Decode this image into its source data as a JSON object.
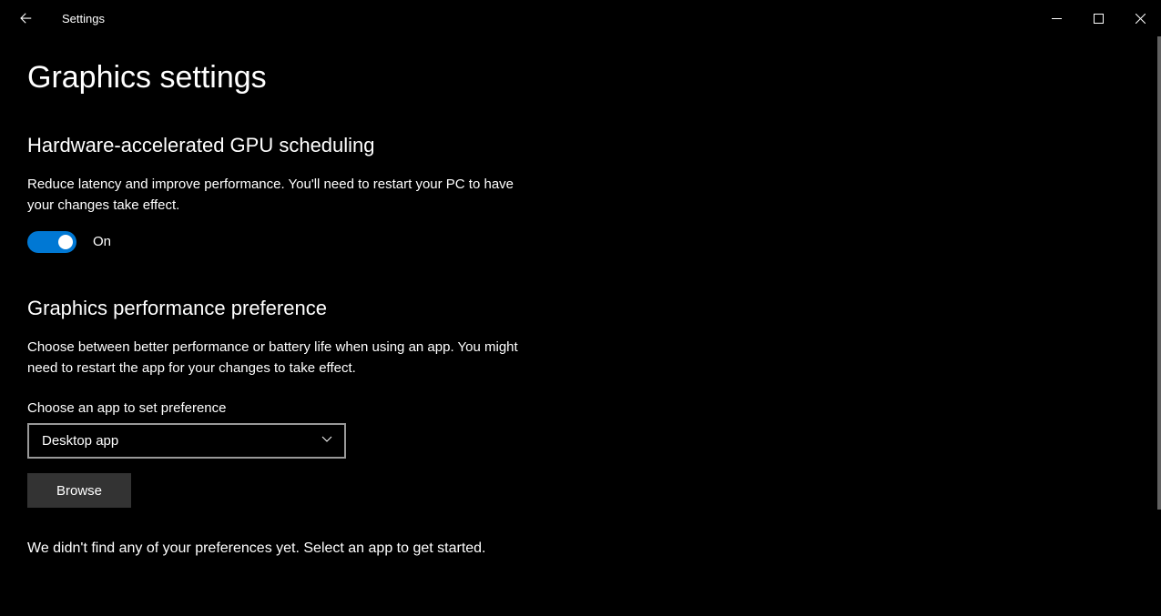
{
  "window": {
    "app_title": "Settings"
  },
  "page": {
    "title": "Graphics settings"
  },
  "gpu_scheduling": {
    "heading": "Hardware-accelerated GPU scheduling",
    "description": "Reduce latency and improve performance. You'll need to restart your PC to have your changes take effect.",
    "toggle_state": "On",
    "toggle_on": true
  },
  "performance_pref": {
    "heading": "Graphics performance preference",
    "description": "Choose between better performance or battery life when using an app. You might need to restart the app for your changes to take effect.",
    "choose_label": "Choose an app to set preference",
    "dropdown_value": "Desktop app",
    "browse_label": "Browse",
    "empty_message": "We didn't find any of your preferences yet. Select an app to get started."
  },
  "colors": {
    "accent": "#0078d4",
    "background": "#000000",
    "button_bg": "#333333",
    "border": "#999999"
  }
}
